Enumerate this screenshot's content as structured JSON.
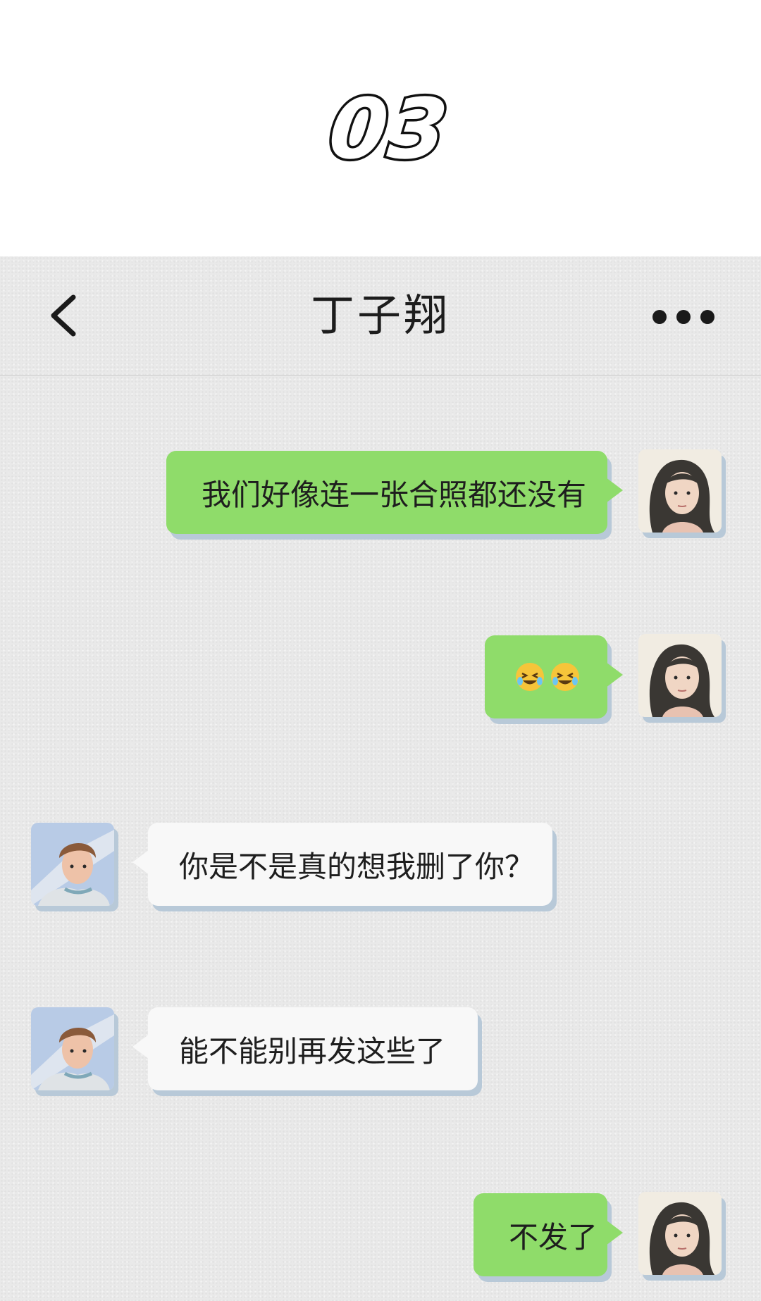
{
  "chapter": {
    "number": "03"
  },
  "chat_header": {
    "contact_name": "丁子翔",
    "back_icon": "chevron-left-icon",
    "more_icon": "more-dots-icon"
  },
  "messages": [
    {
      "sender": "me",
      "text": "我们好像连一张合照都还没有"
    },
    {
      "sender": "me",
      "emoji": [
        "crying-laughing-face",
        "crying-laughing-face"
      ]
    },
    {
      "sender": "them",
      "text": "你是不是真的想我删了你？"
    },
    {
      "sender": "them",
      "text": "能不能别再发这些了"
    },
    {
      "sender": "me",
      "text": "不发了"
    }
  ],
  "colors": {
    "my_bubble": "#8fdc6a",
    "their_bubble": "#f8f8f8",
    "chat_background": "#e9e9e9",
    "shadow": "#b8c9d8"
  }
}
